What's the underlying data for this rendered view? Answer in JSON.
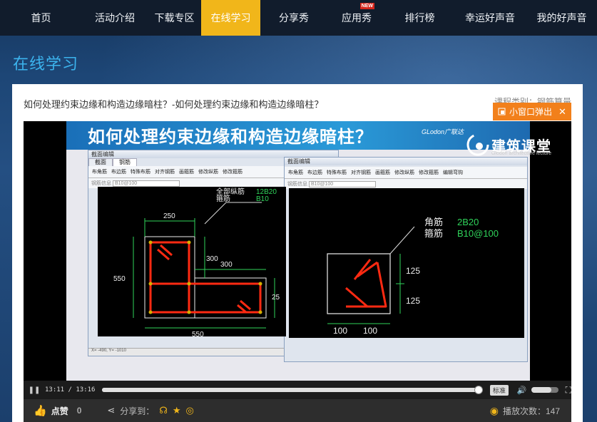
{
  "nav": {
    "items": [
      {
        "label": "首页",
        "active": false
      },
      {
        "label": "活动介绍",
        "active": false
      },
      {
        "label": "下载专区",
        "active": false
      },
      {
        "label": "在线学习",
        "active": true
      },
      {
        "label": "分享秀",
        "active": false
      },
      {
        "label": "应用秀",
        "active": false,
        "badge": "NEW"
      },
      {
        "label": "排行榜",
        "active": false
      },
      {
        "label": "幸运好声音",
        "active": false
      },
      {
        "label": "我的好声音",
        "active": false
      }
    ]
  },
  "page": {
    "section_title": "在线学习"
  },
  "video": {
    "title": "如何处理约束边缘和构造边缘暗柱？-如何处理约束边缘和构造边缘暗柱？",
    "category": "课程类别：钢筋算量",
    "popup_label": "小窗口弹出",
    "frame": {
      "banner_title": "如何处理约束边缘和构造边缘暗柱？",
      "banner_brand": "GLodon广联达",
      "logo_name": "建筑课堂",
      "logo_sub": "Glodon architecture lecture",
      "left_window": {
        "title": "截面编辑",
        "tabs": [
          "截面",
          "钢筋"
        ],
        "toolbar": [
          "布角筋",
          "布边筋",
          "特殊布筋",
          "对齐钢筋",
          "画箍筋",
          "修改纵筋",
          "修改箍筋"
        ],
        "selector": "B10@100",
        "selector_label": "钢筋信息",
        "status": "X= -490, Y= -1010"
      },
      "right_window": {
        "title": "截面编辑",
        "toolbar": [
          "布角筋",
          "布边筋",
          "特殊布筋",
          "对齐钢筋",
          "画箍筋",
          "修改纵筋",
          "修改箍筋",
          "编辑弯钩"
        ],
        "selector": "B10@100",
        "selector_label": "钢筋信息"
      },
      "cad_left": {
        "dims": [
          "250",
          "300",
          "300",
          "550",
          "550",
          "25"
        ],
        "labels": [
          "全部纵筋",
          "箍筋",
          "12B20",
          "B10"
        ]
      },
      "cad_right": {
        "labels": [
          "角筋",
          "箍筋",
          "2B20",
          "B10@100"
        ],
        "dims": [
          "125",
          "125",
          "100",
          "100"
        ]
      }
    },
    "player": {
      "time": "13:11 / 13:16",
      "progress": 0.99,
      "quality": "标准",
      "volume": 0.75
    },
    "actions": {
      "like_label": "点赞",
      "like_count": "0",
      "share_label": "分享到：",
      "plays_label": "播放次数：147"
    }
  },
  "colors": {
    "accent": "#f1b61a",
    "nav_bg": "#111c2c",
    "title_blue": "#3cb4ee",
    "popup": "#f2801b"
  }
}
